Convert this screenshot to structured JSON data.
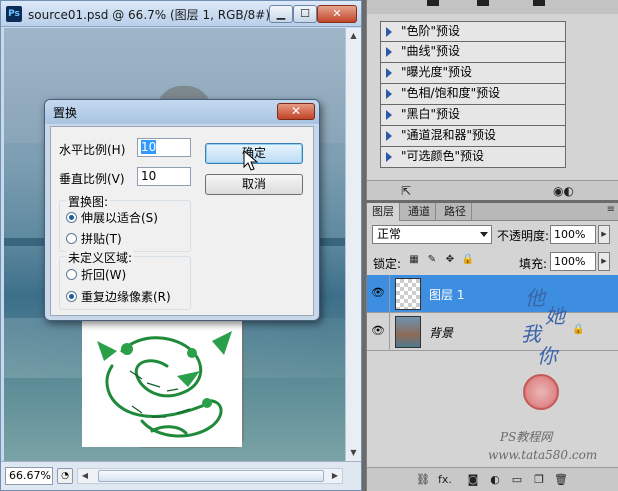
{
  "document": {
    "title": "source01.psd @ 66.7% (图层 1, RGB/8#) *",
    "logo": "Ps",
    "buttons": {
      "minimize": "▁",
      "maximize": "☐",
      "close": "✕"
    },
    "zoom": "66.67%"
  },
  "dialog": {
    "title": "置换",
    "close": "✕",
    "horizontal_label": "水平比例(H)",
    "horizontal_value": "10",
    "vertical_label": "垂直比例(V)",
    "vertical_value": "10",
    "ok_label": "确定",
    "cancel_label": "取消",
    "map_group": {
      "legend": "置换图:",
      "options": [
        {
          "label": "伸展以适合(S)",
          "selected": true
        },
        {
          "label": "拼贴(T)",
          "selected": false
        }
      ]
    },
    "undefined_group": {
      "legend": "未定义区域:",
      "options": [
        {
          "label": "折回(W)",
          "selected": false
        },
        {
          "label": "重复边缘像素(R)",
          "selected": true
        }
      ]
    }
  },
  "adjustments": {
    "items": [
      "\"色阶\"预设",
      "\"曲线\"预设",
      "\"曝光度\"预设",
      "\"色相/饱和度\"预设",
      "\"黑白\"预设",
      "\"通道混和器\"预设",
      "\"可选颜色\"预设"
    ],
    "icons": {
      "back": "back-to-list-icon",
      "mask": "clip-mask-icon"
    }
  },
  "layers_panel": {
    "tabs": [
      "图层",
      "通道",
      "路径"
    ],
    "active_tab": 0,
    "menu_icon": "≡",
    "blend_mode": "正常",
    "opacity_label": "不透明度:",
    "opacity": "100%",
    "lock_label": "锁定:",
    "fill_label": "填充:",
    "fill": "100%",
    "layers": [
      {
        "name": "图层 1",
        "selected": true,
        "visible": true
      },
      {
        "name": "背景",
        "selected": false,
        "visible": true,
        "locked": true
      }
    ],
    "bottom_icons": [
      "link-icon",
      "fx-icon",
      "mask-icon",
      "adjustment-icon",
      "group-icon",
      "new-layer-icon",
      "trash-icon"
    ],
    "fx_label": "fx."
  },
  "watermark": {
    "chars": [
      "他",
      "她",
      "我",
      "你"
    ],
    "line1": "PS教程网",
    "line2": "www.tata580.com"
  },
  "colors": {
    "selection_blue": "#3d8ee0",
    "dialog_frame": "#c8d8ea",
    "close_red": "#c0432a"
  }
}
